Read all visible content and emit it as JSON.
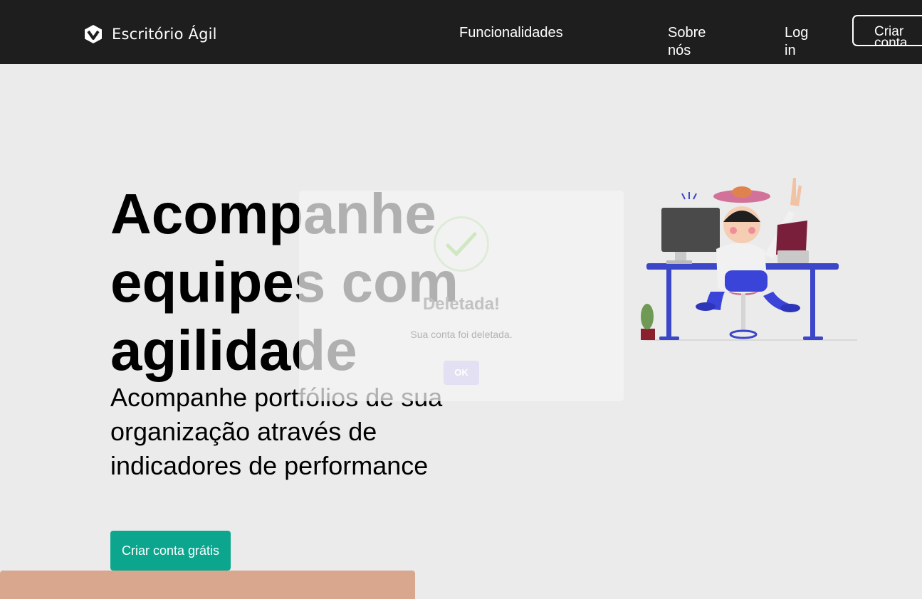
{
  "header": {
    "brand_name": "Escritório Ágil",
    "nav": {
      "features": "Funcionalidades",
      "about": "Sobre nós",
      "login": "Log in",
      "signup": "Criar conta"
    }
  },
  "hero": {
    "title": "Acompanhe equipes com agilidade",
    "subtitle": "Acompanhe portfólios de sua organização através de indicadores de performance",
    "cta": "Criar conta grátis"
  },
  "modal": {
    "title": "Deletada!",
    "text": "Sua conta foi deletada.",
    "ok_label": "OK",
    "icon": "success-check-icon"
  },
  "colors": {
    "topbar": "#1e1e1e",
    "page_background": "#ebebeb",
    "cta": "#0ca68e",
    "peach_bar": "#d9a78e",
    "success_check": "#a5dc86",
    "ok_button": "#e2e0f2"
  }
}
